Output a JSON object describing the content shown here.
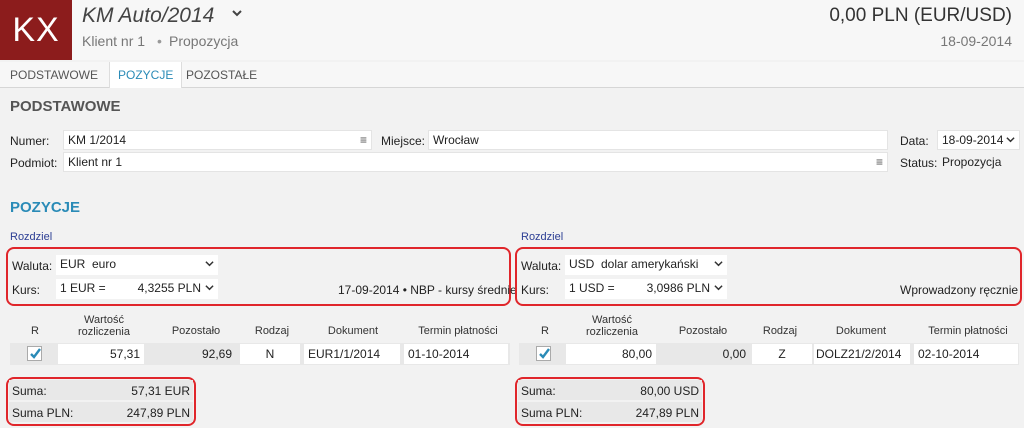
{
  "header": {
    "logo": "KX",
    "title": "KM Auto/2014",
    "client": "Klient nr 1",
    "separator": "•",
    "status": "Propozycja",
    "amount": "0,00 PLN (EUR/USD)",
    "date": "18-09-2014"
  },
  "tabs": [
    "PODSTAWOWE",
    "POZYCJE",
    "POZOSTAŁE"
  ],
  "basic": {
    "section_title": "PODSTAWOWE",
    "numer_label": "Numer:",
    "numer_value": "KM 1/2014",
    "miejsce_label": "Miejsce:",
    "miejsce_value": "Wrocław",
    "data_label": "Data:",
    "data_value": "18-09-2014",
    "podmiot_label": "Podmiot:",
    "podmiot_value": "Klient nr 1",
    "status_label": "Status:",
    "status_value": "Propozycja"
  },
  "positions": {
    "section_title": "POZYCJE",
    "panels": [
      {
        "rozdziel": "Rozdziel",
        "waluta_label": "Waluta:",
        "currency_code": "EUR",
        "currency_name": "euro",
        "kurs_label": "Kurs:",
        "rate_left": "1 EUR =",
        "rate_right": "4,3255 PLN",
        "rate_info": "17-09-2014 • NBP - kursy średnie",
        "columns": [
          "R",
          "Wartość rozliczenia",
          "Pozostało",
          "Rodzaj",
          "Dokument",
          "Termin płatności"
        ],
        "row": {
          "value": "57,31",
          "remaining": "92,69",
          "type": "N",
          "document": "EUR1/1/2014",
          "due": "01-10-2014"
        },
        "suma_label": "Suma:",
        "suma_value": "57,31 EUR",
        "suma_pln_label": "Suma PLN:",
        "suma_pln_value": "247,89 PLN"
      },
      {
        "rozdziel": "Rozdziel",
        "waluta_label": "Waluta:",
        "currency_code": "USD",
        "currency_name": "dolar amerykański",
        "kurs_label": "Kurs:",
        "rate_left": "1 USD =",
        "rate_right": "3,0986 PLN",
        "rate_info": "Wprowadzony ręcznie",
        "columns": [
          "R",
          "Wartość rozliczenia",
          "Pozostało",
          "Rodzaj",
          "Dokument",
          "Termin płatności"
        ],
        "row": {
          "value": "80,00",
          "remaining": "0,00",
          "type": "Z",
          "document": "DOLZ21/2/2014",
          "due": "02-10-2014"
        },
        "suma_label": "Suma:",
        "suma_value": "80,00 USD",
        "suma_pln_label": "Suma PLN:",
        "suma_pln_value": "247,89 PLN"
      }
    ]
  },
  "colors": {
    "logo_bg": "#8c1c1c",
    "accent": "#2a8bb7",
    "highlight": "#e0262b",
    "check": "#2a8bb7"
  }
}
